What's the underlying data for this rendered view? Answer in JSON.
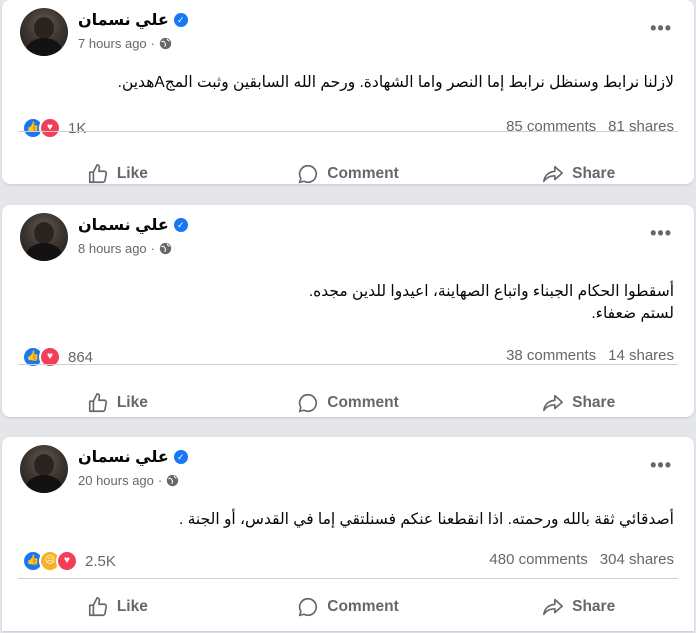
{
  "posts": [
    {
      "author": "علي نسمان",
      "time": "7 hours ago",
      "text": "لازلنا نرابط وسنظل نرابط إما النصر واما الشهادة. ورحم الله السابقين وثبت المجAهدين.",
      "reactions": [
        "like",
        "love"
      ],
      "reaction_count": "1K",
      "comments": "85 comments",
      "shares": "81 shares"
    },
    {
      "author": "علي نسمان",
      "time": "8 hours ago",
      "text": "أسقطوا الحكام الجبناء واتباع الصهاينة، اعيدوا للدين مجده.\nلستم ضعفاء.",
      "reactions": [
        "like",
        "love"
      ],
      "reaction_count": "864",
      "comments": "38 comments",
      "shares": "14 shares"
    },
    {
      "author": "علي نسمان",
      "time": "20 hours ago",
      "text": "أصدقائي ثقة بالله ورحمته. اذا انقطعنا عنكم فسنلتقي إما في القدس، أو الجنة .",
      "reactions": [
        "like",
        "sad",
        "love"
      ],
      "reaction_count": "2.5K",
      "comments": "480 comments",
      "shares": "304 shares"
    }
  ],
  "actions": {
    "like": "Like",
    "comment": "Comment",
    "share": "Share"
  },
  "icons": {
    "verified": "verified-badge-icon",
    "visibility": "globe-icon",
    "more": "more-options-icon"
  },
  "colors": {
    "like": "#1877f2",
    "love": "#f33e58",
    "sad": "#f7b125",
    "secondary_text": "#65676b"
  }
}
